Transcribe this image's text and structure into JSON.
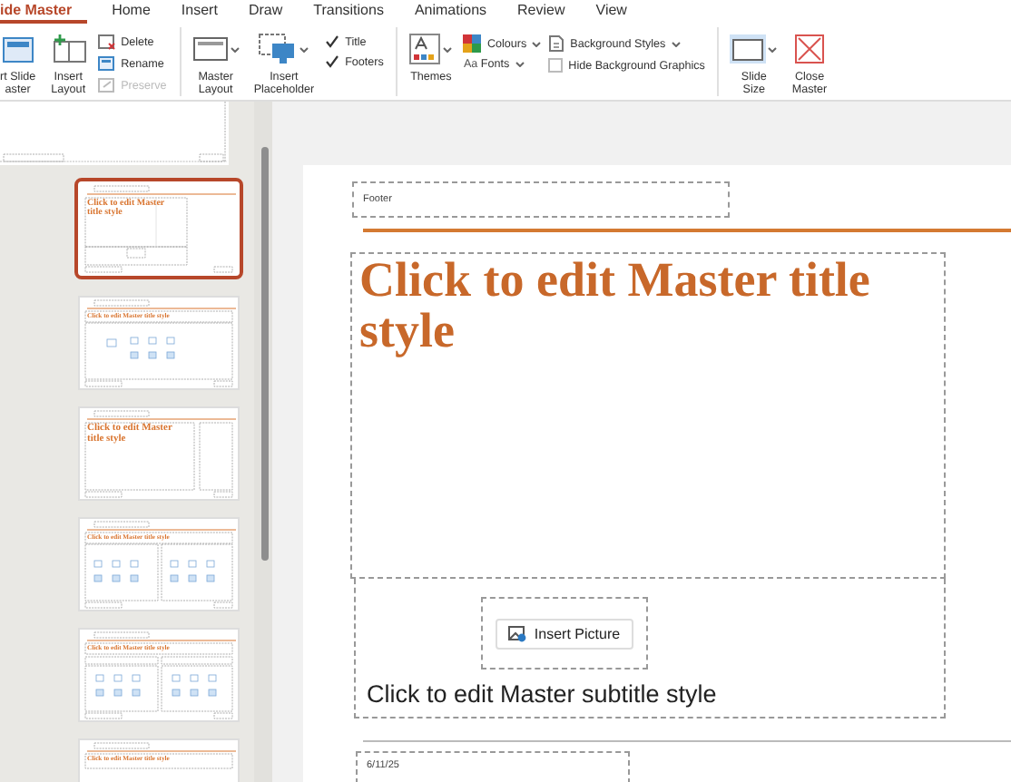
{
  "tabs": [
    {
      "label": "ide Master",
      "selected": true
    },
    {
      "label": "Home",
      "selected": false
    },
    {
      "label": "Insert",
      "selected": false
    },
    {
      "label": "Draw",
      "selected": false
    },
    {
      "label": "Transitions",
      "selected": false
    },
    {
      "label": "Animations",
      "selected": false
    },
    {
      "label": "Review",
      "selected": false
    },
    {
      "label": "View",
      "selected": false
    }
  ],
  "ribbon": {
    "groups": [
      {
        "items": [
          {
            "kind": "large",
            "lines": [
              "rt Slide",
              "aster"
            ],
            "caret": false
          },
          {
            "kind": "large",
            "lines": [
              "Insert",
              "Layout"
            ],
            "caret": false
          },
          {
            "kind": "stack",
            "items": [
              {
                "kind": "small",
                "label": "Delete",
                "disabled": false
              },
              {
                "kind": "small",
                "label": "Rename",
                "disabled": false
              },
              {
                "kind": "small",
                "label": "Preserve",
                "disabled": true
              }
            ]
          }
        ]
      },
      {
        "items": [
          {
            "kind": "large",
            "lines": [
              "Master",
              "Layout"
            ],
            "caret": true
          },
          {
            "kind": "large",
            "lines": [
              "Insert",
              "Placeholder"
            ],
            "caret": true
          },
          {
            "kind": "stack",
            "items": [
              {
                "kind": "check",
                "label": "Title",
                "checked": true
              },
              {
                "kind": "check",
                "label": "Footers",
                "checked": true
              }
            ]
          }
        ]
      },
      {
        "items": [
          {
            "kind": "large",
            "lines": [
              "Themes"
            ],
            "caret": true
          },
          {
            "kind": "stack",
            "items": [
              {
                "kind": "dropdown",
                "label": "Colours"
              },
              {
                "kind": "dropdown",
                "prefix": "Aa",
                "label": "Fonts"
              }
            ]
          },
          {
            "kind": "stack",
            "items": [
              {
                "kind": "dropdown",
                "label": "Background Styles"
              },
              {
                "kind": "check",
                "label": "Hide Background Graphics",
                "checked": false
              }
            ]
          }
        ]
      },
      {
        "items": [
          {
            "kind": "large",
            "lines": [
              "Slide",
              "Size"
            ],
            "caret": true
          },
          {
            "kind": "large",
            "lines": [
              "Close",
              "Master"
            ],
            "caret": false
          }
        ]
      }
    ]
  },
  "thumbnails": [
    {
      "kind": "partial",
      "selected": false
    },
    {
      "kind": "title",
      "selected": true,
      "title": "Click to edit Master title style"
    },
    {
      "kind": "content",
      "selected": false,
      "title": "Click to edit Master title style"
    },
    {
      "kind": "section",
      "selected": false,
      "title": "Click to edit Master title style"
    },
    {
      "kind": "two-content",
      "selected": false,
      "title": "Click to edit Master title style"
    },
    {
      "kind": "comparison",
      "selected": false,
      "title": "Click to edit Master title style"
    },
    {
      "kind": "title-only",
      "selected": false,
      "title": "Click to edit Master title style"
    }
  ],
  "slide": {
    "footer": "Footer",
    "title": "Click to edit Master title style",
    "picture_button": "Insert Picture",
    "subtitle": "Click to edit Master subtitle style",
    "date": "6/11/25"
  }
}
